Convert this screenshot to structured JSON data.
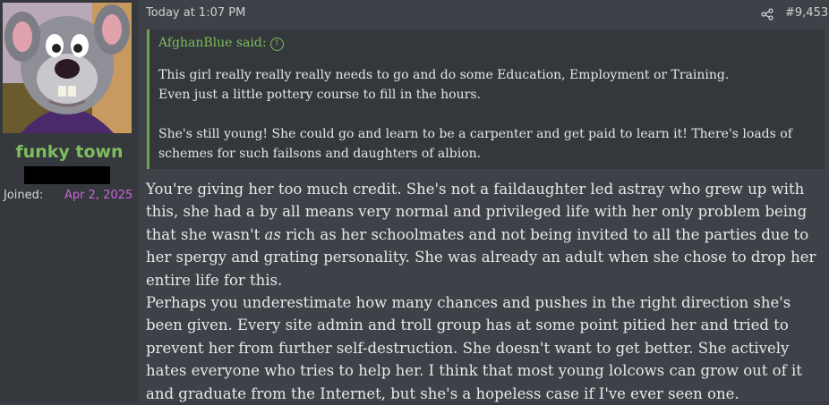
{
  "user": {
    "name": "funky town",
    "joined_label": "Joined:",
    "joined_date": "Apr 2, 2025"
  },
  "post": {
    "timestamp": "Today at 1:07 PM",
    "number": "#9,453",
    "share_icon": "share-icon",
    "quote": {
      "author": "AfghanBlue said:",
      "up_icon": "arrow-up-circle-icon",
      "paragraphs": [
        "This girl really really really needs to go and do some Education, Employment or Training.",
        "Even just a little pottery course to fill in the hours.",
        "She's still young! She could go and learn to be a carpenter and get paid to learn it! There's loads of schemes for such failsons and daughters of albion."
      ]
    },
    "body": {
      "p1_before": "You're giving her too much credit. She's not a faildaughter led astray who grew up with this, she had a by all means very normal and privileged life with her only problem being that she wasn't ",
      "p1_italic": "as",
      "p1_after": " rich as her schoolmates and not being invited to all the parties due to her spergy and grating personality. She was already an adult when she chose to drop her entire life for this.",
      "p2": "Perhaps you underestimate how many chances and pushes in the right direction she's been given. Every site admin and troll group has at some point pitied her and tried to prevent her from further self-destruction. She doesn't want to get better. She actively hates everyone who tries to help her. I think that most young lolcows can grow out of it and graduate from the Internet, but she's a hopeless case if I've ever seen one."
    }
  },
  "colors": {
    "username": "#7ebd5d",
    "joined_date": "#c966d8",
    "quote_border": "#6aa84f"
  }
}
